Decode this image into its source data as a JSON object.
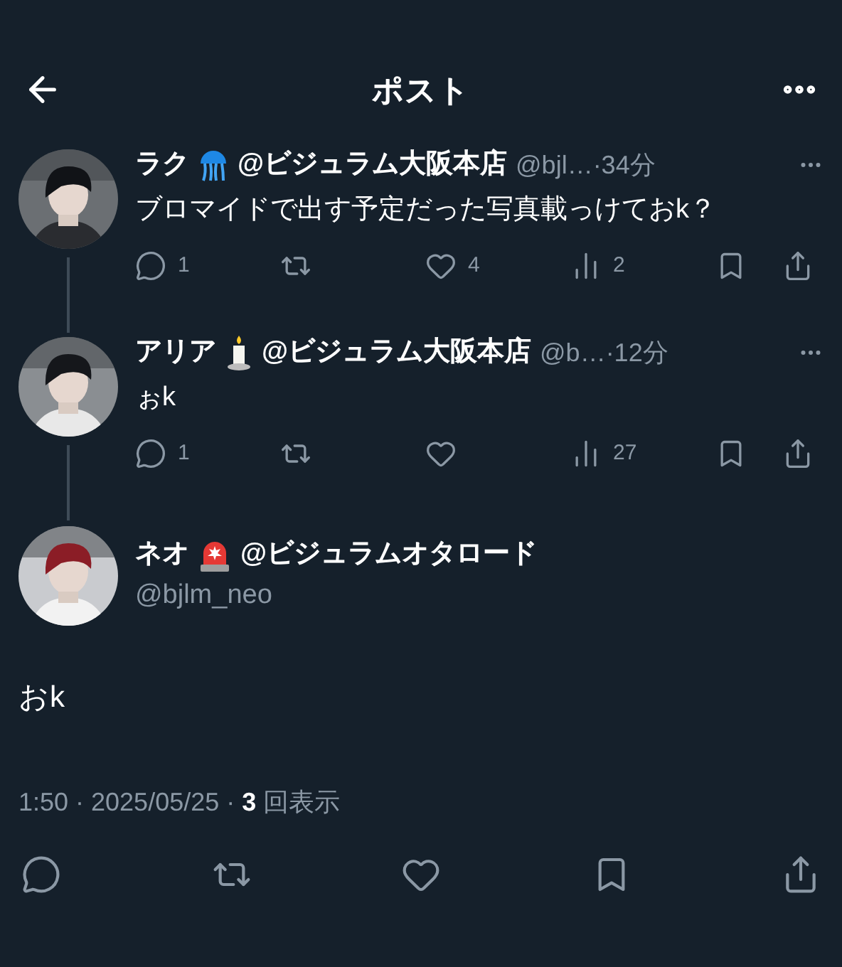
{
  "header": {
    "title": "ポスト"
  },
  "replies": [
    {
      "name": "ラク",
      "affiliation": "@ビジュラム大阪本店",
      "meta": "@bjl…·34分",
      "text": "ブロマイドで出す予定だった写真載っけておk？",
      "actions": [
        {
          "kind": "reply",
          "count": "1"
        },
        {
          "kind": "repost"
        },
        {
          "kind": "like",
          "count": "4"
        },
        {
          "kind": "views",
          "count": "2"
        },
        {
          "kind": "bookmark"
        },
        {
          "kind": "share"
        }
      ]
    },
    {
      "name": "アリア",
      "affiliation": "@ビジュラム大阪本店",
      "meta": "@b…·12分",
      "text": "ぉk",
      "actions": [
        {
          "kind": "reply",
          "count": "1"
        },
        {
          "kind": "repost"
        },
        {
          "kind": "like"
        },
        {
          "kind": "views",
          "count": "27"
        },
        {
          "kind": "bookmark"
        },
        {
          "kind": "share"
        }
      ]
    }
  ],
  "post": {
    "name": "ネオ",
    "affiliation": "@ビジュラムオタロード",
    "handle": "@bjlm_neo",
    "text": "おk",
    "timestamp": "1:50 · 2025/05/25 · **3** 回表示",
    "actions": [
      {
        "kind": "reply"
      },
      {
        "kind": "repost"
      },
      {
        "kind": "like"
      },
      {
        "kind": "bookmark"
      },
      {
        "kind": "share"
      }
    ]
  }
}
